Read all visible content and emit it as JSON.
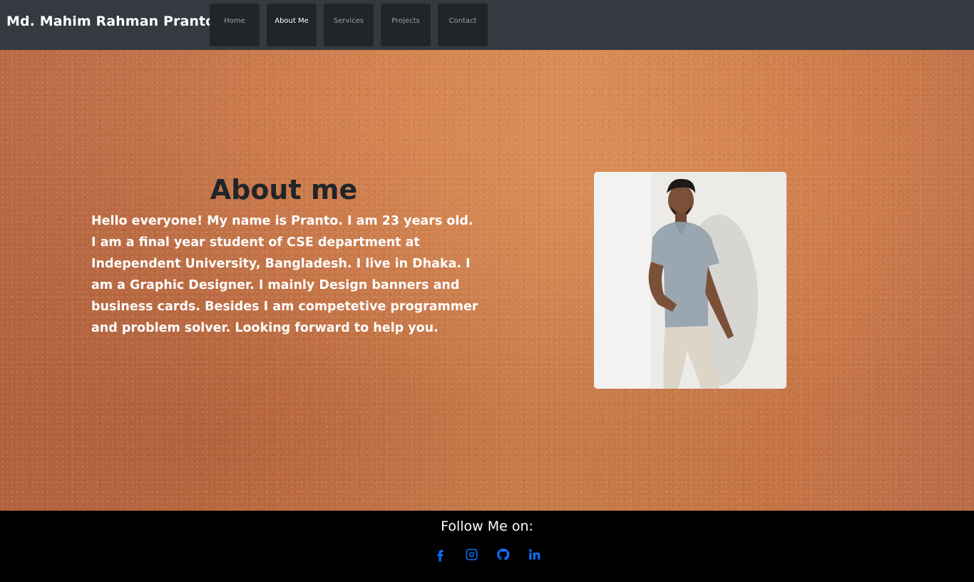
{
  "header": {
    "brand": "Md. Mahim Rahman Pranto",
    "nav": [
      {
        "label": "Home",
        "active": false
      },
      {
        "label": "About Me",
        "active": true
      },
      {
        "label": "Services",
        "active": false
      },
      {
        "label": "Projects",
        "active": false
      },
      {
        "label": "Contact",
        "active": false
      }
    ]
  },
  "about": {
    "title": "About me",
    "text": "Hello everyone! My name is Pranto. I am 23 years old. I am a final year student of CSE department at Independent University, Bangladesh. I live in Dhaka. I am a Graphic Designer. I mainly Design banners and business cards. Besides I am competetive programmer and problem solver. Looking forward to help you."
  },
  "footer": {
    "follow_label": "Follow Me on:",
    "social": [
      {
        "icon": "facebook-icon"
      },
      {
        "icon": "instagram-icon"
      },
      {
        "icon": "github-icon"
      },
      {
        "icon": "linkedin-icon"
      }
    ],
    "icon_color": "#0d6efd"
  },
  "colors": {
    "navbar": "#343a40",
    "nav_button": "#212529",
    "footer": "#000000",
    "title": "#212529"
  }
}
